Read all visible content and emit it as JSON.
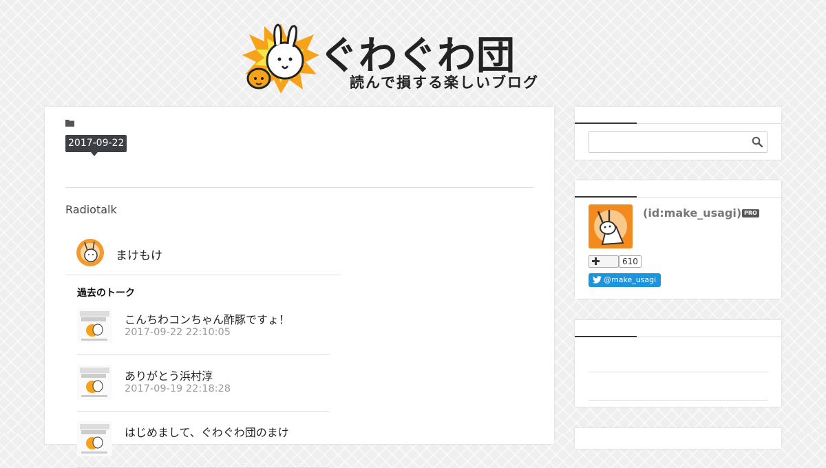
{
  "header": {
    "title": "ぐわぐわ団",
    "subtitle": "読んで損する楽しいブログ"
  },
  "main": {
    "date_badge": "2017-09-22",
    "section_title": "Radiotalk",
    "radiotalk": {
      "user_name": "まけもけ",
      "past_talks_label": "過去のトーク",
      "talks": [
        {
          "title": "こんちわコンちゃん酢豚ですょ！",
          "time": "2017-09-22 22:10:05"
        },
        {
          "title": "ありがとう浜村淳",
          "time": "2017-09-19 22:18:28"
        },
        {
          "title": "はじめまして、ぐわぐわ団のまけ",
          "time": ""
        }
      ]
    }
  },
  "sidebar": {
    "search": {
      "placeholder": ""
    },
    "profile": {
      "id": "(id:make_usagi)",
      "pro_badge": "PRO",
      "follow_count": "610",
      "twitter_label": "@make_usagi"
    }
  },
  "colors": {
    "badge_bg": "#3d3f44",
    "twitter_blue": "#1b95e0",
    "logo_orange": "#f7a21b",
    "logo_yellow": "#f5e64a"
  },
  "icons": [
    "folder-icon",
    "search-icon",
    "plus-icon",
    "twitter-bird-icon"
  ]
}
